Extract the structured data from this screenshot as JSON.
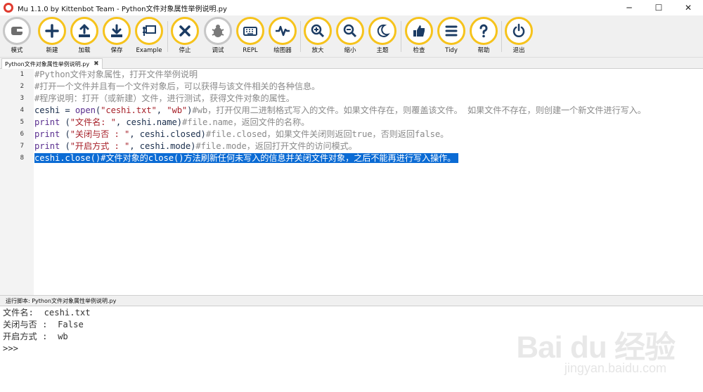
{
  "window": {
    "title": "Mu 1.1.0 by Kittenbot Team - Python文件对象属性举例说明.py",
    "min_glyph": "─",
    "max_glyph": "☐",
    "close_glyph": "✕"
  },
  "toolbar": {
    "mode": "模式",
    "new": "新建",
    "load": "加载",
    "save": "保存",
    "example": "Example",
    "stop": "停止",
    "debug": "调试",
    "repl": "REPL",
    "plotter": "绘图器",
    "zoom_in": "放大",
    "zoom_out": "缩小",
    "theme": "主题",
    "check": "检查",
    "tidy": "Tidy",
    "help": "帮助",
    "quit": "退出"
  },
  "tab": {
    "label": "Python文件对象属性举例说明.py",
    "close_glyph": "✖"
  },
  "editor": {
    "line_numbers": [
      "1",
      "2",
      "3",
      "4",
      "5",
      "6",
      "7",
      "8"
    ],
    "lines": [
      [
        {
          "t": "#Python文件对象属性，打开文件举例说明",
          "c": "cm"
        }
      ],
      [
        {
          "t": "#打开一个文件并且有一个文件对象后，可以获得与该文件相关的各种信息。",
          "c": "cm"
        }
      ],
      [
        {
          "t": "#程序说明：打开（或新建）文件，进行测试，获得文件对象的属性。",
          "c": "cm"
        }
      ],
      [
        {
          "t": "ceshi = ",
          "c": "pl"
        },
        {
          "t": "open",
          "c": "kw"
        },
        {
          "t": "(",
          "c": "pl"
        },
        {
          "t": "\"ceshi.txt\"",
          "c": "st"
        },
        {
          "t": ", ",
          "c": "pl"
        },
        {
          "t": "\"wb\"",
          "c": "st"
        },
        {
          "t": ")",
          "c": "pl"
        },
        {
          "t": "#wb，打开仅用二进制格式写入的文件。如果文件存在，则覆盖该文件。 如果文件不存在，则创建一个新文件进行写入。",
          "c": "cm"
        }
      ],
      [
        {
          "t": "print",
          "c": "kw"
        },
        {
          "t": " (",
          "c": "pl"
        },
        {
          "t": "\"文件名: \"",
          "c": "st"
        },
        {
          "t": ", ceshi.name)",
          "c": "pl"
        },
        {
          "t": "#file.name，返回文件的名称。",
          "c": "cm"
        }
      ],
      [
        {
          "t": "print",
          "c": "kw"
        },
        {
          "t": " (",
          "c": "pl"
        },
        {
          "t": "\"关闭与否 : \"",
          "c": "st"
        },
        {
          "t": ", ceshi.closed)",
          "c": "pl"
        },
        {
          "t": "#file.closed，如果文件关闭则返回true，否则返回false。",
          "c": "cm"
        }
      ],
      [
        {
          "t": "print",
          "c": "kw"
        },
        {
          "t": " (",
          "c": "pl"
        },
        {
          "t": "\"开启方式 : \"",
          "c": "st"
        },
        {
          "t": ", ceshi.mode)",
          "c": "pl"
        },
        {
          "t": "#file.mode，返回打开文件的访问模式。",
          "c": "cm"
        }
      ],
      [
        {
          "t": "ceshi.close()#文件对象的close()方法刷新任何未写入的信息并关闭文件对象，之后不能再进行写入操作。",
          "c": "sel"
        }
      ]
    ]
  },
  "repl": {
    "title": "运行脚本: Python文件对象属性举例说明.py",
    "lines": [
      "文件名:  ceshi.txt",
      "关闭与否 :  False",
      "开启方式 :  wb",
      ">>>"
    ]
  },
  "watermark": {
    "main": "Bai du 经验",
    "sub": "jingyan.baidu.com"
  }
}
